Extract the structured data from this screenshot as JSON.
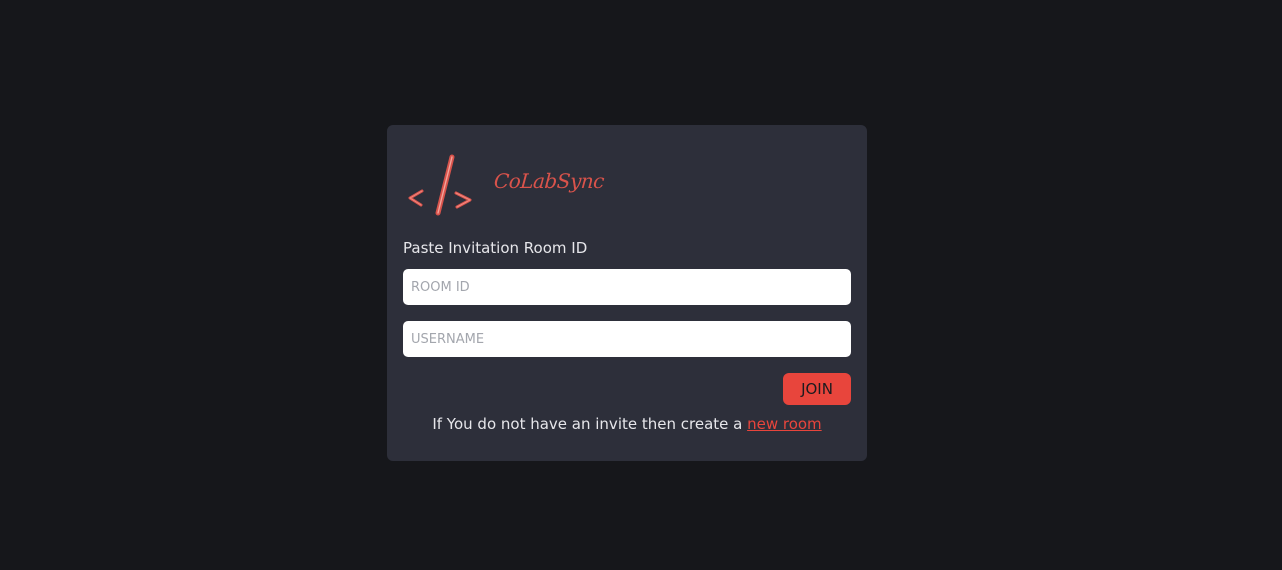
{
  "brand": {
    "name": "CoLabSync",
    "accent_color": "#e8453c",
    "logo_icon": "code-brackets-icon"
  },
  "form": {
    "label": "Paste Invitation Room ID",
    "room_id_placeholder": "ROOM ID",
    "room_id_value": "",
    "username_placeholder": "USERNAME",
    "username_value": "",
    "join_label": "JOIN"
  },
  "footer": {
    "prefix_text": "If You do not have an invite then create a ",
    "link_text": "new room"
  }
}
